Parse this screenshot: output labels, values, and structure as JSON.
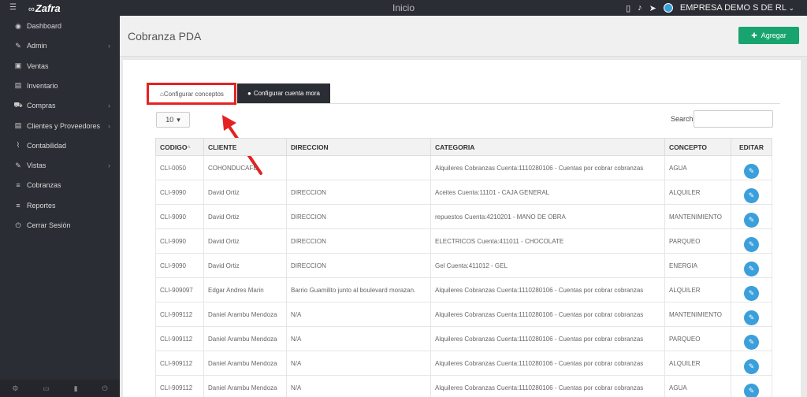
{
  "topbar": {
    "logo": "Zafra",
    "title": "Inicio",
    "company": "EMPRESA DEMO S DE RL"
  },
  "sidebar": {
    "items": [
      {
        "label": "Dashboard",
        "icon": "dashboard-icon",
        "has_children": false
      },
      {
        "label": "Admin",
        "icon": "wrench-icon",
        "has_children": true
      },
      {
        "label": "Ventas",
        "icon": "money-icon",
        "has_children": false
      },
      {
        "label": "Inventario",
        "icon": "book-icon",
        "has_children": false
      },
      {
        "label": "Compras",
        "icon": "cart-icon",
        "has_children": true
      },
      {
        "label": "Clientes y Proveedores",
        "icon": "book-icon",
        "has_children": true
      },
      {
        "label": "Contabilidad",
        "icon": "paperclip-icon",
        "has_children": false
      },
      {
        "label": "Vistas",
        "icon": "edit-icon",
        "has_children": true
      },
      {
        "label": "Cobranzas",
        "icon": "list-icon",
        "has_children": false
      },
      {
        "label": "Reportes",
        "icon": "list-icon",
        "has_children": false
      },
      {
        "label": "Cerrar Sesión",
        "icon": "power-icon",
        "has_children": false
      }
    ]
  },
  "page": {
    "title": "Cobranza PDA",
    "add_label": "Agregar"
  },
  "tabs": [
    {
      "label": "Configurar conceptos",
      "active": true
    },
    {
      "label": "Configurar cuenta mora",
      "active": false
    }
  ],
  "table_controls": {
    "page_size": "10",
    "search_label": "Search:",
    "search_value": ""
  },
  "table": {
    "headers": [
      "CODIGO",
      "CLIENTE",
      "DIRECCION",
      "CATEGORIA",
      "CONCEPTO",
      "EDITAR"
    ],
    "rows": [
      [
        "CLI-0050",
        "COHONDUCAFE",
        "",
        "Alquileres Cobranzas Cuenta:1110280106 - Cuentas por cobrar cobranzas",
        "AGUA"
      ],
      [
        "CLI-9090",
        "David Ortiz",
        "DIRECCION",
        "Aceites Cuenta:11101 - CAJA GENERAL",
        "ALQUILER"
      ],
      [
        "CLI-9090",
        "David Ortiz",
        "DIRECCION",
        "repuestos Cuenta:4210201 - MANO DE OBRA",
        "MANTENIMIENTO"
      ],
      [
        "CLI-9090",
        "David Ortiz",
        "DIRECCION",
        "ELECTRICOS Cuenta:411011 - CHOCOLATE",
        "PARQUEO"
      ],
      [
        "CLI-9090",
        "David Ortiz",
        "DIRECCION",
        "Gel Cuenta:411012 - GEL",
        "ENERGIA"
      ],
      [
        "CLI-909097",
        "Edgar Andres Marin",
        "Barrio Guamilito junto al boulevard morazan.",
        "Alquileres Cobranzas Cuenta:1110280106 - Cuentas por cobrar cobranzas",
        "ALQUILER"
      ],
      [
        "CLI-909112",
        "Daniel Arambu Mendoza",
        "N/A",
        "Alquileres Cobranzas Cuenta:1110280106 - Cuentas por cobrar cobranzas",
        "MANTENIMIENTO"
      ],
      [
        "CLI-909112",
        "Daniel Arambu Mendoza",
        "N/A",
        "Alquileres Cobranzas Cuenta:1110280106 - Cuentas por cobrar cobranzas",
        "PARQUEO"
      ],
      [
        "CLI-909112",
        "Daniel Arambu Mendoza",
        "N/A",
        "Alquileres Cobranzas Cuenta:1110280106 - Cuentas por cobrar cobranzas",
        "ALQUILER"
      ],
      [
        "CLI-909112",
        "Daniel Arambu Mendoza",
        "N/A",
        "Alquileres Cobranzas Cuenta:1110280106 - Cuentas por cobrar cobranzas",
        "AGUA"
      ]
    ]
  },
  "colors": {
    "sidebar_bg": "#2a2d33",
    "add_button": "#18a46f",
    "edit_button": "#3a9fda",
    "annotation": "#e52222"
  }
}
